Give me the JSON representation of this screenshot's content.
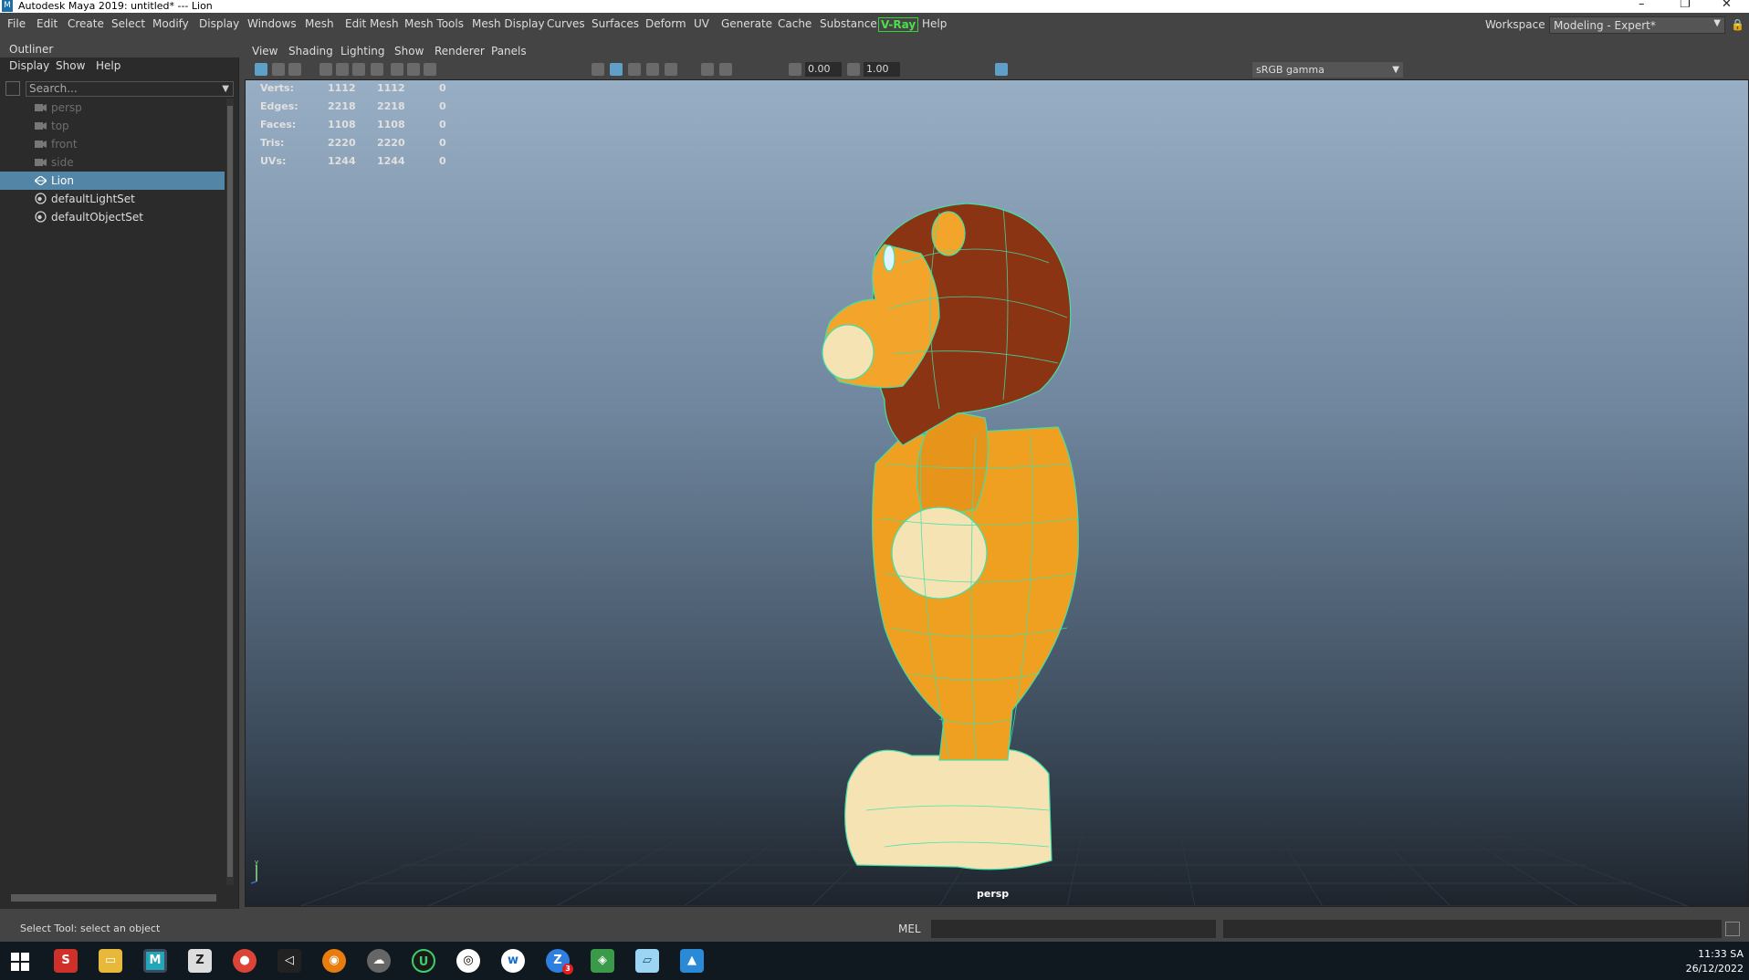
{
  "window": {
    "title": "Autodesk Maya 2019: untitled*   ---   Lion",
    "logo": "M"
  },
  "menubar": {
    "items": [
      "File",
      "Edit",
      "Create",
      "Select",
      "Modify",
      "Display",
      "Windows",
      "Mesh",
      "Edit Mesh",
      "Mesh Tools",
      "Mesh Display",
      "Curves",
      "Surfaces",
      "Deform",
      "UV",
      "Generate",
      "Cache",
      "Substance",
      "V-Ray",
      "Help"
    ],
    "workspace_label": "Workspace :",
    "workspace_value": "Modeling - Expert*"
  },
  "outliner": {
    "title": "Outliner",
    "menu": [
      "Display",
      "Show",
      "Help"
    ],
    "search_placeholder": "Search...",
    "items": [
      {
        "label": "persp",
        "type": "camera",
        "selected": false
      },
      {
        "label": "top",
        "type": "camera",
        "selected": false
      },
      {
        "label": "front",
        "type": "camera",
        "selected": false
      },
      {
        "label": "side",
        "type": "camera",
        "selected": false
      },
      {
        "label": "Lion",
        "type": "mesh",
        "selected": true
      },
      {
        "label": "defaultLightSet",
        "type": "set",
        "selected": false
      },
      {
        "label": "defaultObjectSet",
        "type": "set",
        "selected": false
      }
    ]
  },
  "panel": {
    "menu": [
      "View",
      "Shading",
      "Lighting",
      "Show",
      "Renderer",
      "Panels"
    ],
    "exposure": "0.00",
    "gamma": "1.00",
    "color_space": "sRGB gamma"
  },
  "hud": {
    "rows": [
      {
        "label": "Verts:",
        "v1": "1112",
        "v2": "1112",
        "v3": "0"
      },
      {
        "label": "Edges:",
        "v1": "2218",
        "v2": "2218",
        "v3": "0"
      },
      {
        "label": "Faces:",
        "v1": "1108",
        "v2": "1108",
        "v3": "0"
      },
      {
        "label": "Tris:",
        "v1": "2220",
        "v2": "2220",
        "v3": "0"
      },
      {
        "label": "UVs:",
        "v1": "1244",
        "v2": "1244",
        "v3": "0"
      }
    ],
    "camera": "persp"
  },
  "statusbar": {
    "hint": "Select Tool: select an object",
    "mel": "MEL"
  },
  "taskbar": {
    "time": "11:33 SA",
    "date": "26/12/2022",
    "apps": [
      "start-icon",
      "sketchup-icon",
      "file-explorer-icon",
      "maya-icon",
      "zbrush-icon",
      "chrome-icon",
      "unity-icon",
      "blender-icon",
      "cloud-icon",
      "unreal-icon",
      "github-icon",
      "uw-icon",
      "zalo-icon",
      "maps-icon",
      "notes-icon",
      "photos-icon"
    ],
    "badge": "3"
  },
  "colors": {
    "selection": "#5285a6",
    "vray": "#4be04b",
    "wireframe": "#3fe0a8",
    "body": "#f0a020",
    "mane": "#8b3414",
    "cream": "#f5e3b4"
  }
}
